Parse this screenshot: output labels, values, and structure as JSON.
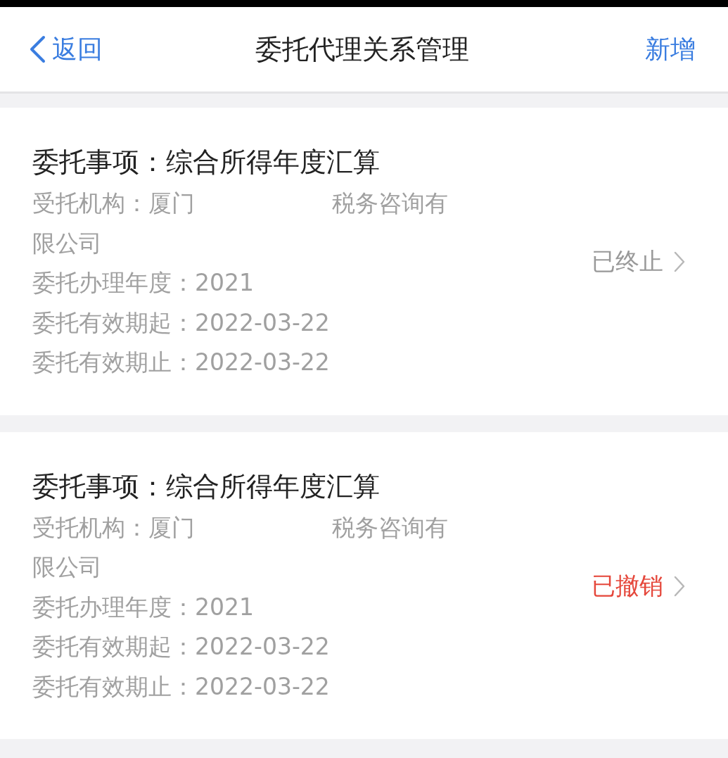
{
  "nav": {
    "back": "返回",
    "title": "委托代理关系管理",
    "action": "新增"
  },
  "records": [
    {
      "matter_label": "委托事项：",
      "matter": "综合所得年度汇算",
      "agency_label": "受托机构：",
      "agency_before": "厦门",
      "agency_after": "税务咨询有限公司",
      "fields": [
        {
          "label": "委托办理年度：",
          "value": "2021"
        },
        {
          "label": "委托有效期起：",
          "value": "2022-03-22"
        },
        {
          "label": "委托有效期止：",
          "value": "2022-03-22"
        }
      ],
      "status": {
        "text": "已终止",
        "color": "#999999"
      }
    },
    {
      "matter_label": "委托事项：",
      "matter": "综合所得年度汇算",
      "agency_label": "受托机构：",
      "agency_before": "厦门",
      "agency_after": "税务咨询有限公司",
      "fields": [
        {
          "label": "委托办理年度：",
          "value": "2021"
        },
        {
          "label": "委托有效期起：",
          "value": "2022-03-22"
        },
        {
          "label": "委托有效期止：",
          "value": "2022-03-22"
        }
      ],
      "status": {
        "text": "已撤销",
        "color": "#e5473b"
      }
    }
  ]
}
